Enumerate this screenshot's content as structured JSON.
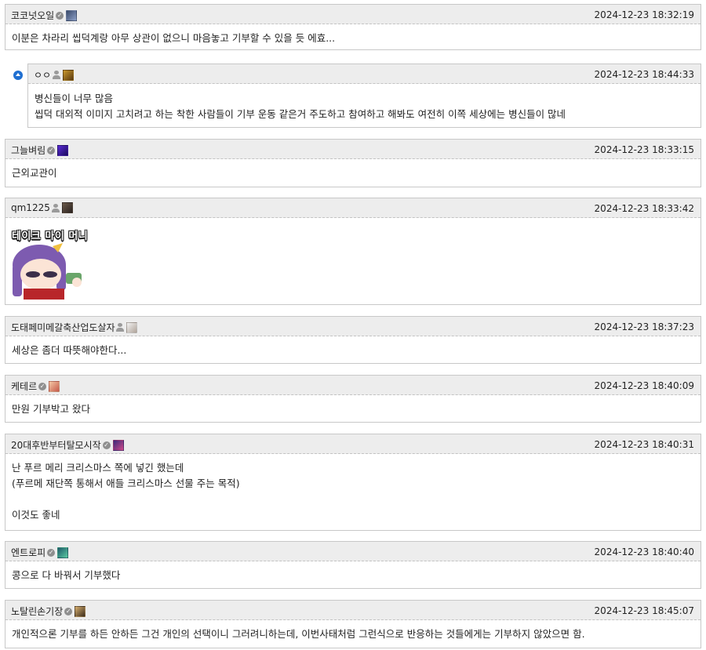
{
  "colors": {
    "header_bg": "#ededed",
    "border": "#c8c8c8",
    "reply_icon": "#1f6fd1"
  },
  "comments": [
    {
      "nick": "코코넛오일",
      "time": "2024-12-23 18:32:19",
      "lines": [
        "이분은 차라리 씹덕계랑 아무 상관이 없으니 마음놓고 기부할 수 있을 듯 에효..."
      ]
    },
    {
      "nick": "ㅇㅇ",
      "time": "2024-12-23 18:44:33",
      "lines": [
        "병신들이 너무 많음",
        "씹덕 대외적 이미지 고치려고 하는 착한 사람들이 기부 운동 같은거 주도하고 참여하고 해봐도 여전히 이쪽 세상에는 병신들이 많네"
      ]
    },
    {
      "nick": "그늘벼림",
      "time": "2024-12-23 18:33:15",
      "lines": [
        "근외교관이"
      ]
    },
    {
      "nick": "qm1225",
      "time": "2024-12-23 18:33:42",
      "sticker_text": "테이크 마이 머니"
    },
    {
      "nick": "도태페미메갈축산업도살자",
      "time": "2024-12-23 18:37:23",
      "lines": [
        "세상은 좀더 따뜻해야한다..."
      ]
    },
    {
      "nick": "케테르",
      "time": "2024-12-23 18:40:09",
      "lines": [
        "만원 기부박고 왔다"
      ]
    },
    {
      "nick": "20대후반부터탈모시작",
      "time": "2024-12-23 18:40:31",
      "lines": [
        "난 푸르 메리 크리스마스 쪽에 넣긴 했는데",
        "(푸르메 재단쪽 통해서 애들 크리스마스 선물 주는 목적)",
        "",
        "이것도 좋네"
      ]
    },
    {
      "nick": "엔트로피",
      "time": "2024-12-23 18:40:40",
      "lines": [
        "콩으로 다 바꿔서 기부했다"
      ]
    },
    {
      "nick": "노탈린손기장",
      "time": "2024-12-23 18:45:07",
      "lines": [
        "개인적으론 기부를 하든 안하든 그건 개인의 선택이니 그러려니하는데, 이번사태처럼 그런식으로 반응하는 것들에게는 기부하지 않았으면 함."
      ]
    }
  ]
}
